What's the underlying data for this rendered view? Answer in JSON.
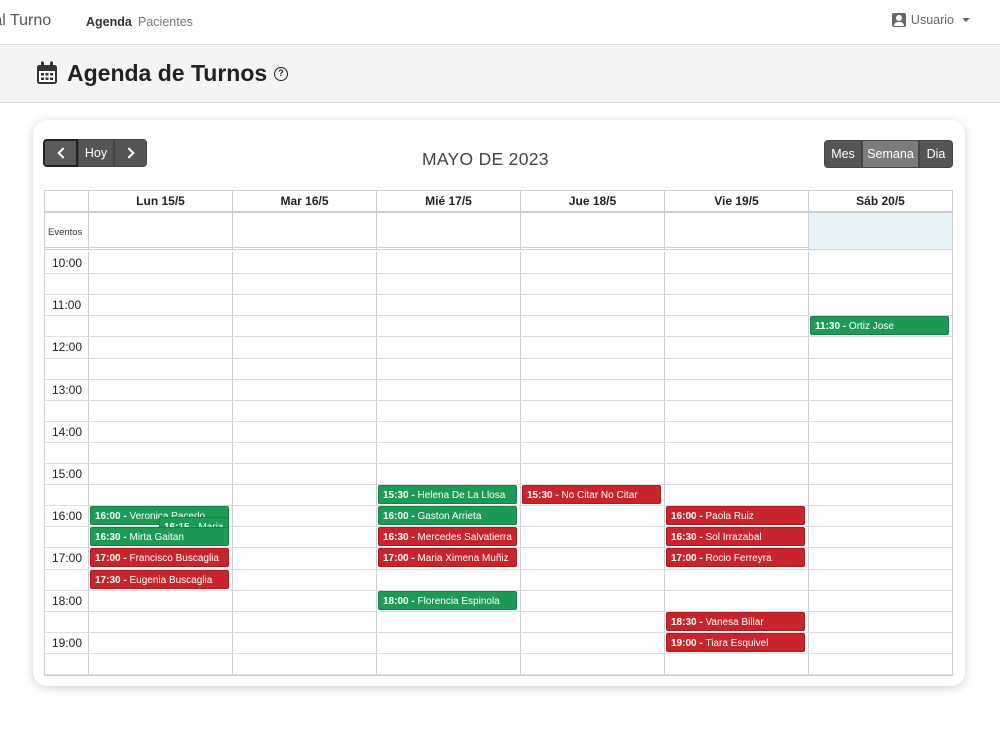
{
  "navbar": {
    "brand": "ntal Turno",
    "links": [
      "Agenda",
      "Pacientes"
    ],
    "user": "Usuario"
  },
  "header": {
    "title": "Agenda de Turnos",
    "help": "?"
  },
  "toolbar": {
    "today": "Hoy",
    "title": "MAYO DE 2023",
    "views": [
      "Mes",
      "Semana",
      "Dia"
    ],
    "active_view": "Semana"
  },
  "calendar": {
    "days": [
      "Lun 15/5",
      "Mar 16/5",
      "Mié 17/5",
      "Jue 18/5",
      "Vie 19/5",
      "Sáb 20/5"
    ],
    "allday_label": "Eventos",
    "today_index": 5,
    "times": [
      "10:00",
      "11:00",
      "12:00",
      "13:00",
      "14:00",
      "15:00",
      "16:00",
      "17:00",
      "18:00",
      "19:00"
    ],
    "events": [
      {
        "day": 0,
        "time": "16:00",
        "name": "Veronica Pacedo",
        "status": "green"
      },
      {
        "day": 0,
        "time": "16:15",
        "name": "Maria",
        "status": "green"
      },
      {
        "day": 0,
        "time": "16:30",
        "name": "Mirta Gaitan",
        "status": "green"
      },
      {
        "day": 0,
        "time": "17:00",
        "name": "Francisco Buscaglia",
        "status": "red"
      },
      {
        "day": 0,
        "time": "17:30",
        "name": "Eugenia Buscaglia",
        "status": "red"
      },
      {
        "day": 2,
        "time": "15:30",
        "name": "Helena De La Llosa",
        "status": "green"
      },
      {
        "day": 2,
        "time": "16:00",
        "name": "Gaston Arrieta",
        "status": "green"
      },
      {
        "day": 2,
        "time": "16:30",
        "name": "Mercedes Salvatierra",
        "status": "red"
      },
      {
        "day": 2,
        "time": "17:00",
        "name": "Maria Ximena Muñiz",
        "status": "red"
      },
      {
        "day": 2,
        "time": "18:00",
        "name": "Florencia Espinola",
        "status": "green"
      },
      {
        "day": 3,
        "time": "15:30",
        "name": "No Citar No Citar",
        "status": "red"
      },
      {
        "day": 4,
        "time": "16:00",
        "name": "Paola Ruiz",
        "status": "red"
      },
      {
        "day": 4,
        "time": "16:30",
        "name": "Sol Irrazabal",
        "status": "red"
      },
      {
        "day": 4,
        "time": "17:00",
        "name": "Rocio Ferreyra",
        "status": "red"
      },
      {
        "day": 4,
        "time": "18:30",
        "name": "Vanesa Billar",
        "status": "red"
      },
      {
        "day": 4,
        "time": "19:00",
        "name": "Tiara Esquivel",
        "status": "red"
      },
      {
        "day": 5,
        "time": "11:30",
        "name": "Ortiz Jose",
        "status": "green"
      }
    ]
  },
  "colors": {
    "green": "#1e9a57",
    "red": "#c8242b",
    "today_bg": "#e6f4fa"
  }
}
